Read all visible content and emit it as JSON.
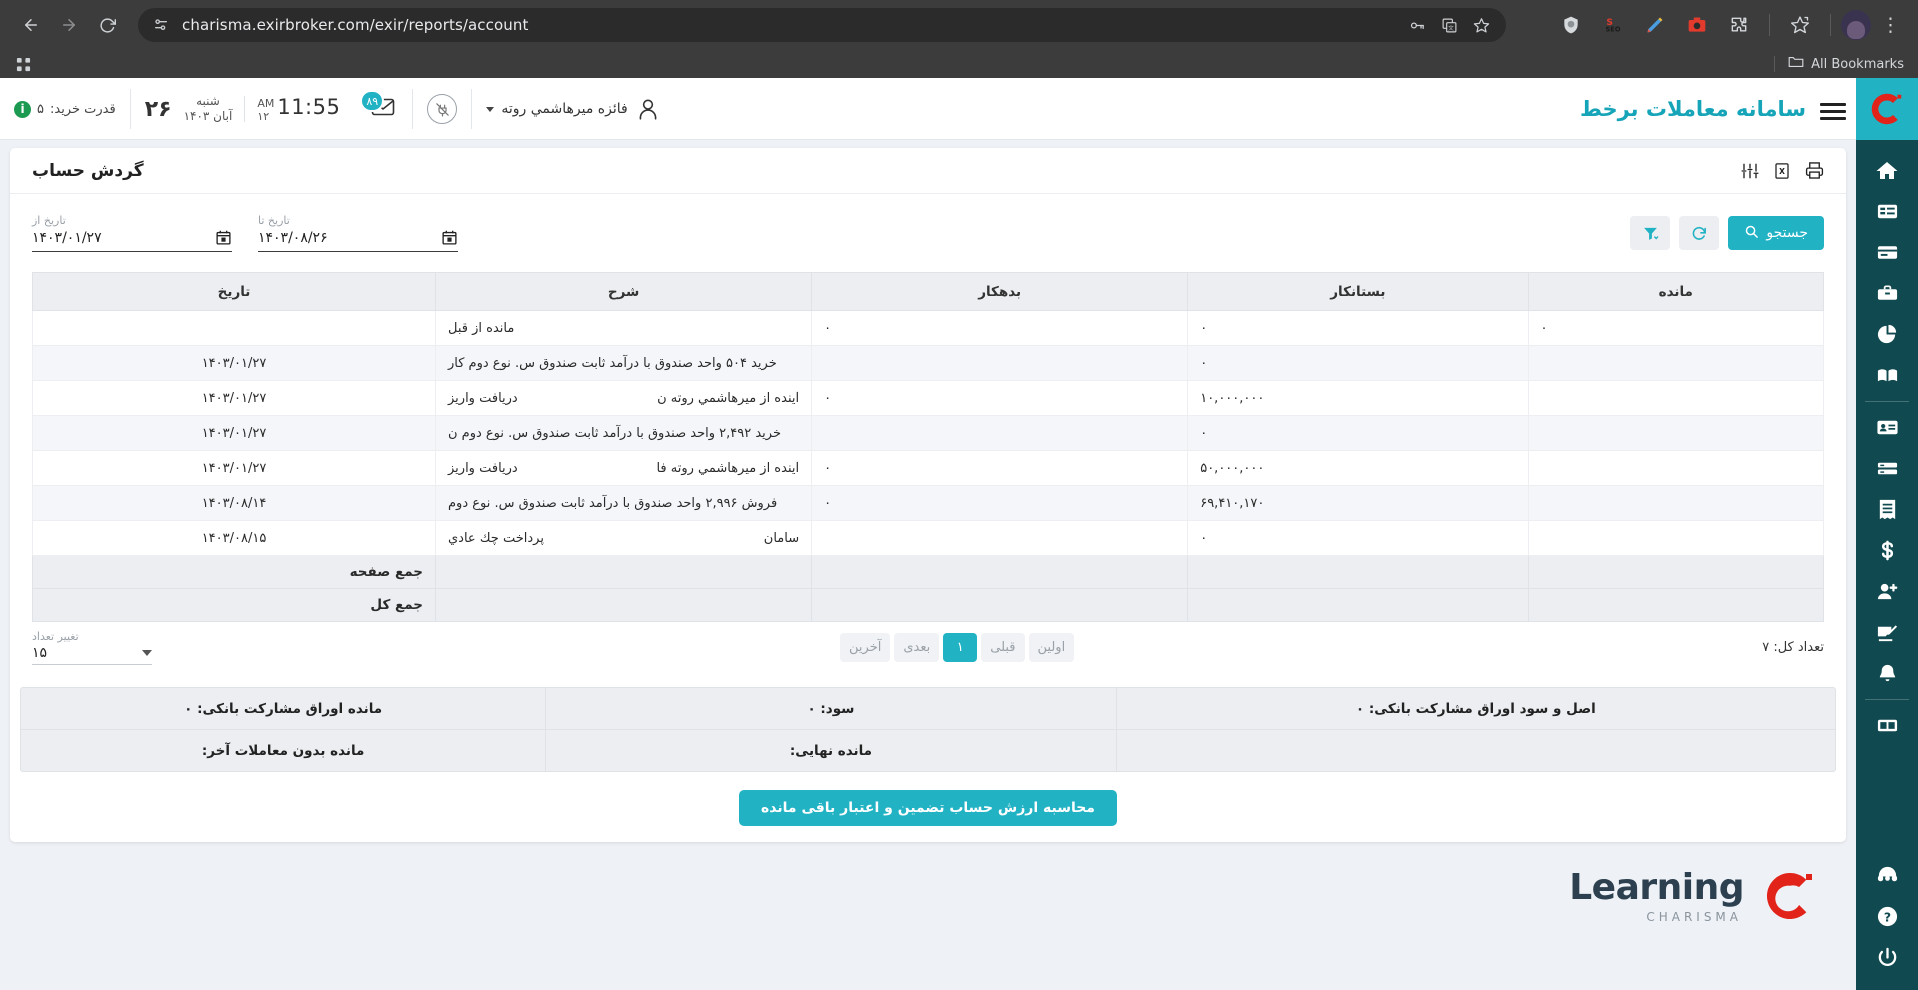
{
  "browser": {
    "url": "charisma.exirbroker.com/exir/reports/account",
    "back_icon": "back-arrow-icon",
    "forward_icon": "forward-arrow-icon",
    "reload_icon": "reload-icon",
    "site_info_icon": "site-settings-icon",
    "omni_icons": [
      "password-key-icon",
      "translate-icon",
      "bookmark-star-icon"
    ],
    "extension_icons": [
      "shield-extension-icon",
      "seo-extension-icon",
      "color-picker-extension-icon",
      "camera-extension-icon",
      "puzzle-extension-icon",
      "bookmark-star-icon"
    ],
    "menu_icon": "three-dots-menu-icon",
    "profile_icon": "profile-avatar-icon",
    "apps_icon": "apps-grid-icon",
    "all_bookmarks_label": "All Bookmarks",
    "folder_icon": "folder-icon"
  },
  "app_header": {
    "title": "سامانه معاملات برخط",
    "logo_icon": "charisma-c-logo",
    "menu_icon": "hamburger-menu-icon",
    "buy_power_label": "قدرت خرید:",
    "buy_power_value": "۵",
    "info_badge": "i",
    "date_day": "۲۶",
    "date_weekday": "شنبه",
    "date_full": "آبان ۱۴۰۳",
    "time": "11:55",
    "time_meridiem": "AM",
    "time_extra": "۱۲",
    "mail_icon": "envelope-icon",
    "mail_badge": "۸۹",
    "plug_icon": "plug-disconnected-icon",
    "user_name": "فائزه ميرهاشمي روته",
    "user_icon": "user-outline-icon",
    "caret_icon": "chevron-down-icon"
  },
  "sidebar": {
    "items": [
      {
        "name": "home-icon"
      },
      {
        "name": "list-icon"
      },
      {
        "name": "card-icon"
      },
      {
        "name": "briefcase-icon"
      },
      {
        "name": "pie-chart-icon"
      },
      {
        "name": "book-icon"
      },
      {
        "name": "id-card-icon"
      },
      {
        "name": "server-icon"
      },
      {
        "name": "receipt-icon"
      },
      {
        "name": "dollar-icon"
      },
      {
        "name": "add-user-icon"
      },
      {
        "name": "signature-icon"
      },
      {
        "name": "bell-icon"
      },
      {
        "name": "table-icon"
      }
    ],
    "bottom_items": [
      {
        "name": "headset-support-icon"
      },
      {
        "name": "help-question-icon"
      },
      {
        "name": "power-logout-icon"
      }
    ]
  },
  "report": {
    "title": "گردش حساب",
    "tools": [
      {
        "name": "settings-sliders-icon"
      },
      {
        "name": "excel-export-icon"
      },
      {
        "name": "print-icon"
      }
    ],
    "date_from": {
      "label": "تاریخ از",
      "value": "۱۴۰۳/۰۱/۲۷",
      "icon": "calendar-icon"
    },
    "date_to": {
      "label": "تاریخ تا",
      "value": "۱۴۰۳/۰۸/۲۶",
      "icon": "calendar-icon"
    },
    "search_button": "جستجو",
    "search_icon": "search-icon",
    "refresh_icon": "refresh-icon",
    "filter_icon": "filter-icon"
  },
  "table": {
    "columns": [
      "مانده",
      "بستانکار",
      "بدهکار",
      "شرح",
      "تاریخ"
    ],
    "rows": [
      {
        "date": "",
        "desc_a": "مانده از قبل",
        "desc_b": "",
        "debit": "۰",
        "credit": "۰",
        "balance": "۰"
      },
      {
        "date": "۱۴۰۳/۰۱/۲۷",
        "desc_a": "خرید ۵۰۴ واحد صندوق با درآمد ثابت صندوق س. نوع دوم کار",
        "desc_b": "",
        "debit": "",
        "credit": "۰",
        "balance": ""
      },
      {
        "date": "۱۴۰۳/۰۱/۲۷",
        "desc_a": "دریافت واریز",
        "desc_b": "آینده از میرهاشمي روته ن",
        "debit": "۰",
        "credit": "۱۰,۰۰۰,۰۰۰",
        "balance": ""
      },
      {
        "date": "۱۴۰۳/۰۱/۲۷",
        "desc_a": "خرید ۲,۴۹۲ واحد صندوق با درآمد ثابت صندوق س. نوع دوم ن",
        "desc_b": "",
        "debit": "",
        "credit": "۰",
        "balance": ""
      },
      {
        "date": "۱۴۰۳/۰۱/۲۷",
        "desc_a": "دریافت واریز",
        "desc_b": "آینده از میرهاشمي روته فا",
        "debit": "۰",
        "credit": "۵۰,۰۰۰,۰۰۰",
        "balance": ""
      },
      {
        "date": "۱۴۰۳/۰۸/۱۴",
        "desc_a": "فروش ۲,۹۹۶ واحد صندوق با درآمد ثابت صندوق س. نوع دوم",
        "desc_b": "",
        "debit": "۰",
        "credit": "۶۹,۴۱۰,۱۷۰",
        "balance": ""
      },
      {
        "date": "۱۴۰۳/۰۸/۱۵",
        "desc_a": "پرداخت چك عادي",
        "desc_b": "سامان",
        "debit": "",
        "credit": "۰",
        "balance": ""
      }
    ],
    "page_total_label": "جمع صفحه",
    "grand_total_label": "جمع کل"
  },
  "pager": {
    "count_label": "تغییر تعداد",
    "count_value": "۱۵",
    "first": "اولین",
    "prev": "قبلی",
    "current": "۱",
    "next": "بعدی",
    "last": "آخرین",
    "total_label": "تعداد کل: ۷"
  },
  "summary": {
    "row1": [
      "مانده اوراق مشارکت بانکی: ۰",
      "سود: ۰",
      "اصل و سود اوراق مشارکت بانکی: ۰"
    ],
    "row2": [
      "مانده بدون معاملات آخر:",
      "مانده نهایی:",
      ""
    ],
    "calc_button": "محاسبه ارزش حساب تضمین و اعتبار باقی مانده"
  },
  "footer": {
    "logo_main": "Learning",
    "logo_sub": "CHARISMA",
    "logo_mark": "charisma-c-logo"
  },
  "colors": {
    "accent": "#21b2c4",
    "sidebar": "#10494f",
    "title": "#16a4b8",
    "chrome": "#3c3c3c"
  }
}
